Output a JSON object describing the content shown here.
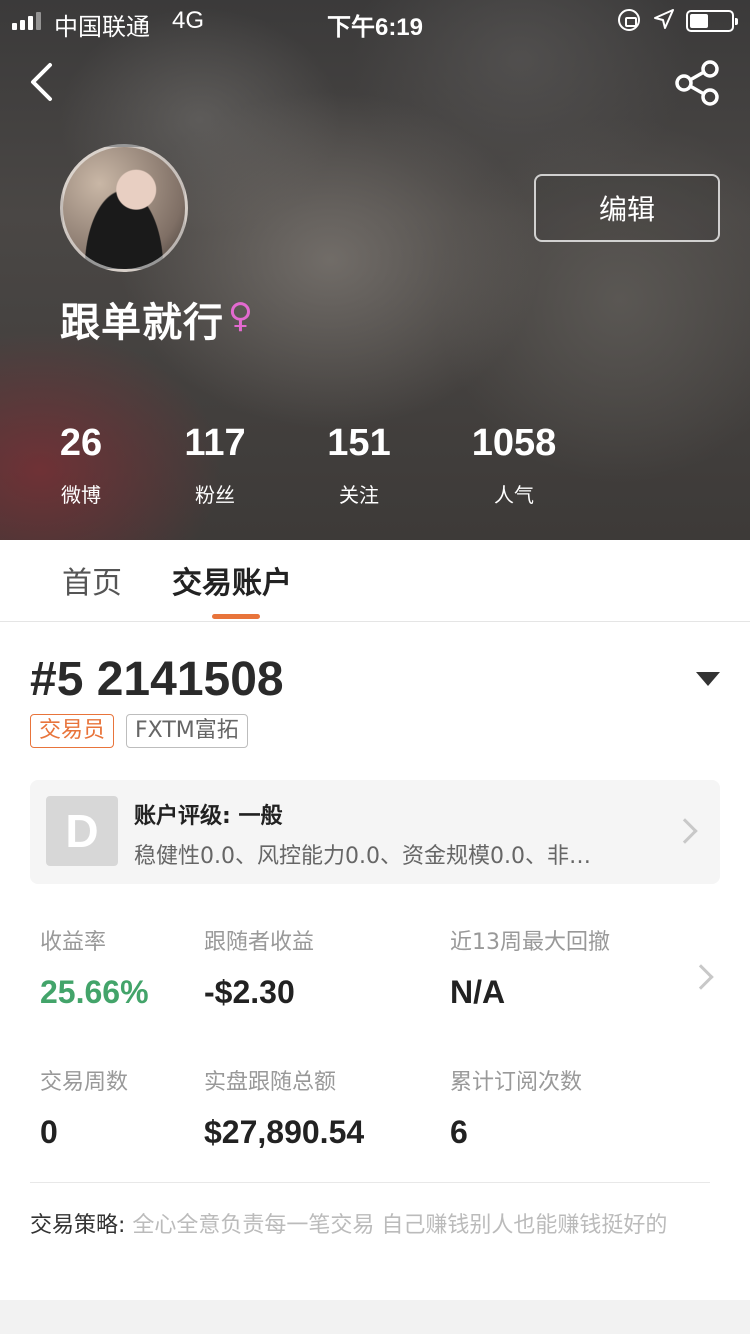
{
  "status_bar": {
    "carrier": "中国联通",
    "network": "4G",
    "time": "下午6:19"
  },
  "profile": {
    "edit_label": "编辑",
    "username": "跟单就行",
    "gender_symbol": "♀",
    "stats": [
      {
        "value": "26",
        "label": "微博"
      },
      {
        "value": "117",
        "label": "粉丝"
      },
      {
        "value": "151",
        "label": "关注"
      },
      {
        "value": "1058",
        "label": "人气"
      }
    ]
  },
  "tabs": [
    {
      "label": "首页",
      "active": false
    },
    {
      "label": "交易账户",
      "active": true
    }
  ],
  "account": {
    "id": "#5 2141508",
    "tags": [
      "交易员",
      "FXTM富拓"
    ],
    "rating": {
      "grade": "D",
      "title": "账户评级: 一般",
      "detail": "稳健性0.0、风控能力0.0、资金规模0.0、非…"
    },
    "metrics": [
      {
        "label": "收益率",
        "value": "25.66%"
      },
      {
        "label": "跟随者收益",
        "value": "-$2.30"
      },
      {
        "label": "近13周最大回撤",
        "value": "N/A"
      },
      {
        "label": "交易周数",
        "value": "0"
      },
      {
        "label": "实盘跟随总额",
        "value": "$27,890.54"
      },
      {
        "label": "累计订阅次数",
        "value": "6"
      }
    ],
    "strategy_key": "交易策略:",
    "strategy_text": "全心全意负责每一笔交易 自己赚钱别人也能赚钱挺好的"
  },
  "colors": {
    "accent": "#e8743b",
    "positive": "#43a46a",
    "gender": "#e36ad0"
  },
  "icons": [
    "back-icon",
    "share-icon",
    "dropdown-icon",
    "chevron-right-icon"
  ]
}
